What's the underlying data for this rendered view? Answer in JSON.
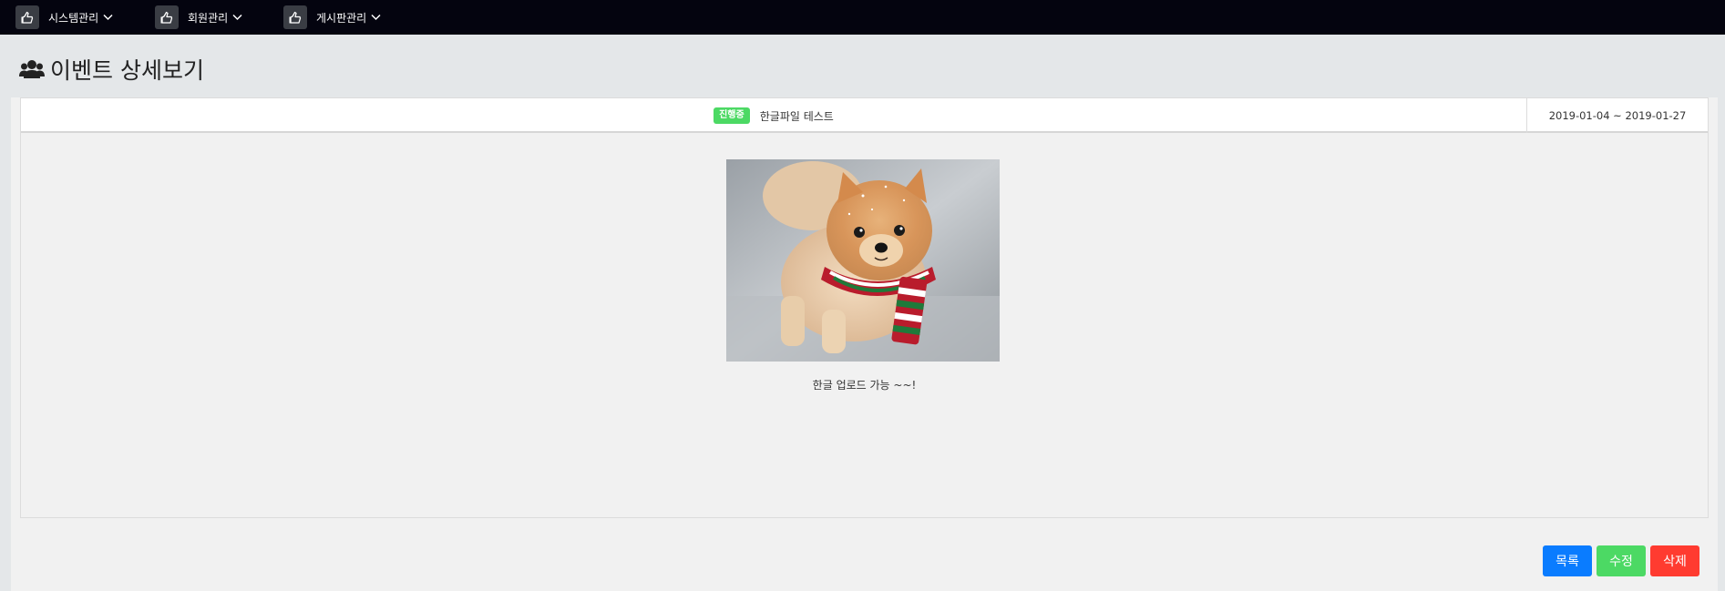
{
  "nav": {
    "items": [
      {
        "label": "시스템관리",
        "icon": "hand-pointer-icon"
      },
      {
        "label": "회원관리",
        "icon": "hand-pointer-icon"
      },
      {
        "label": "게시판관리",
        "icon": "hand-pointer-icon"
      }
    ]
  },
  "page": {
    "title": "이벤트 상세보기",
    "title_icon": "users-icon"
  },
  "event": {
    "status": "진행중",
    "title": "한글파일 테스트",
    "period": "2019-01-04 ~ 2019-01-27",
    "caption": "한글 업로드 가능 ~~!"
  },
  "buttons": {
    "list": "목록",
    "edit": "수정",
    "delete": "삭제"
  },
  "colors": {
    "topbar": "#04040f",
    "status_badge": "#4cd964",
    "list_button": "#0a7cff",
    "edit_button": "#4cd964",
    "delete_button": "#ff3b30"
  }
}
